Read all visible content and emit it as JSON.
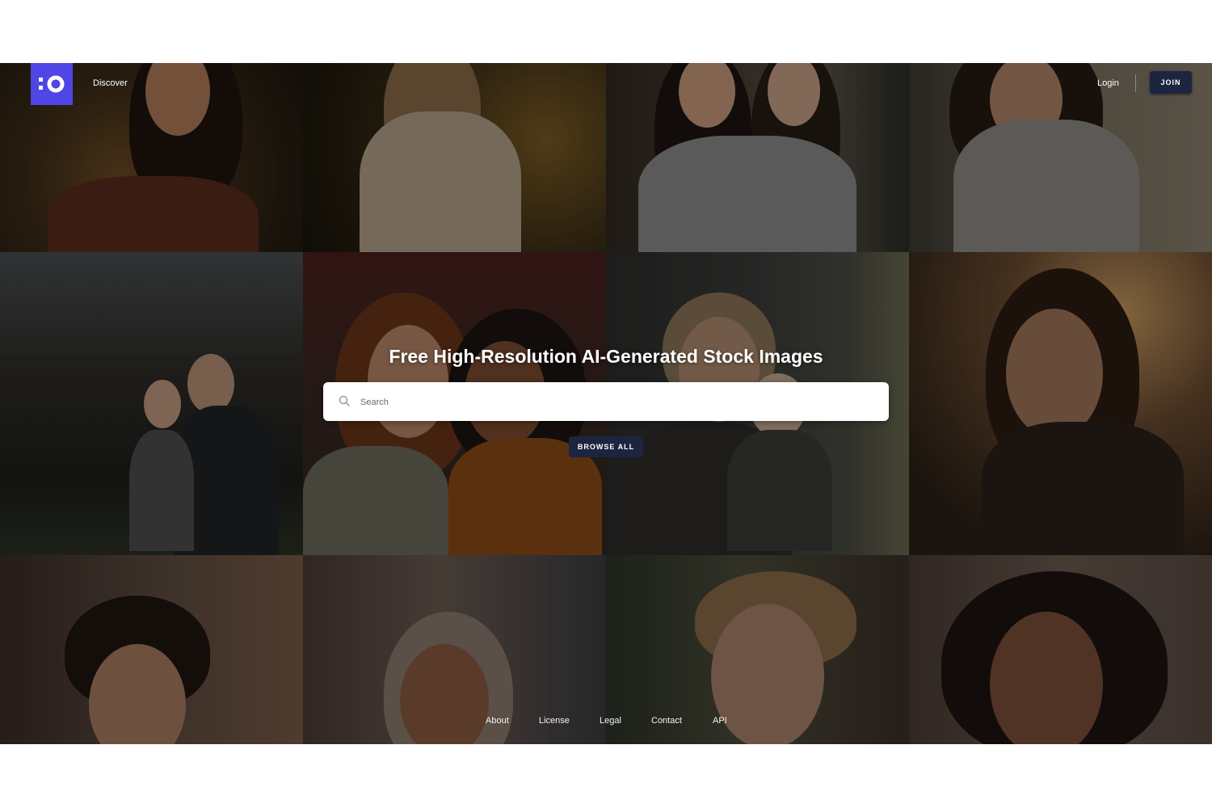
{
  "header": {
    "logo_icon": "brand-logo-icon",
    "discover_label": "Discover",
    "login_label": "Login",
    "join_label": "JOIN"
  },
  "hero": {
    "title": "Free High-Resolution AI-Generated Stock Images",
    "search_placeholder": "Search",
    "search_icon": "search-icon",
    "browse_label": "BROWSE ALL"
  },
  "footer": {
    "links": [
      "About",
      "License",
      "Legal",
      "Contact",
      "API"
    ]
  },
  "colors": {
    "brand": "#4f46e5",
    "button_dark": "#1c2540"
  }
}
